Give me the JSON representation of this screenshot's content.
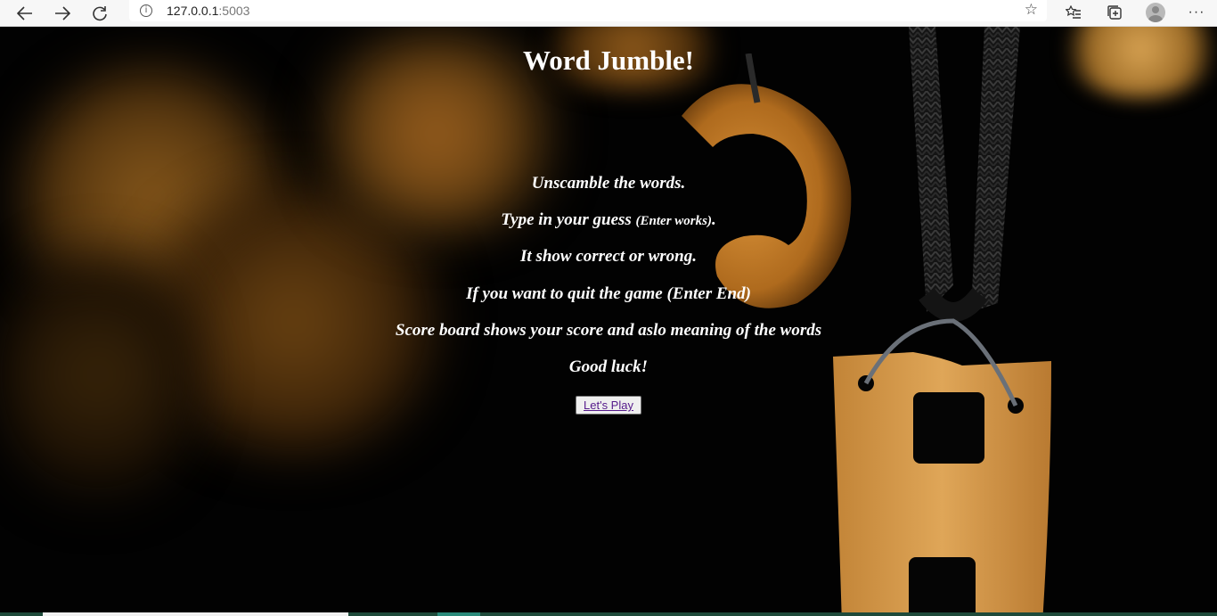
{
  "browser": {
    "url_host": "127.0.0.1",
    "url_port": ":5003",
    "icons": {
      "back": "arrow-left-icon",
      "forward": "arrow-right-icon",
      "reload": "reload-icon",
      "info": "info-icon",
      "favorite": "star-icon",
      "favorites_list": "favorites-icon",
      "collections": "collections-icon",
      "profile": "avatar",
      "more": "more-icon"
    }
  },
  "page": {
    "title": "Word Jumble!",
    "instructions": {
      "line1": "Unscamble the words.",
      "line2_main": "Type in your guess ",
      "line2_small": "(Enter works)",
      "line2_end": ".",
      "line3": "It show correct or wrong.",
      "line4": "If you want to quit the game (Enter End)",
      "line5": "Score board shows your score and aslo meaning of the words",
      "line6": "Good luck!"
    },
    "play_button": "Let's Play"
  }
}
